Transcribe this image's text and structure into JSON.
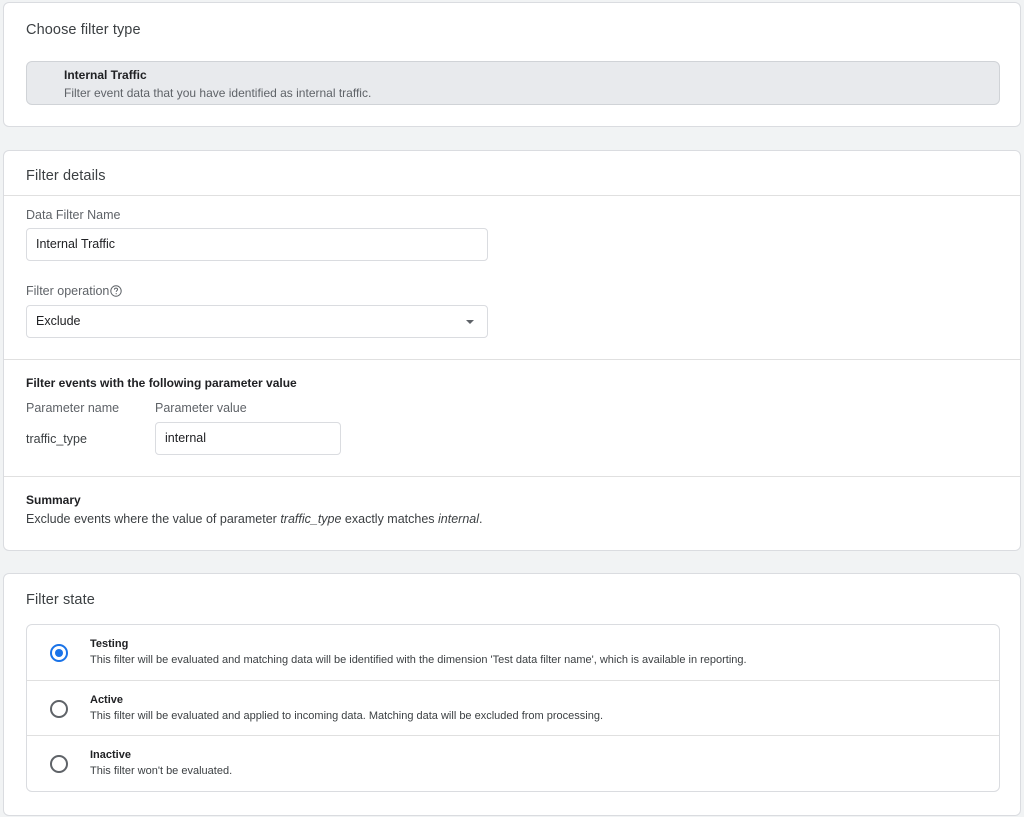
{
  "filter_type": {
    "title": "Choose filter type",
    "option": {
      "label": "Internal Traffic",
      "description": "Filter event data that you have identified as internal traffic."
    }
  },
  "filter_details": {
    "title": "Filter details",
    "name_label": "Data Filter Name",
    "name_value": "Internal Traffic",
    "operation_label": "Filter operation",
    "operation_value": "Exclude",
    "parameter_section_title": "Filter events with the following parameter value",
    "parameter_name_header": "Parameter name",
    "parameter_value_header": "Parameter value",
    "parameter_name": "traffic_type",
    "parameter_value": "internal",
    "summary_title": "Summary",
    "summary": {
      "prefix": "Exclude events where the value of parameter ",
      "param": "traffic_type",
      "middle": " exactly matches ",
      "value": "internal",
      "suffix": "."
    }
  },
  "filter_state": {
    "title": "Filter state",
    "selected": "Testing",
    "options": [
      {
        "label": "Testing",
        "description": "This filter will be evaluated and matching data will be identified with the dimension 'Test data filter name', which is available in reporting."
      },
      {
        "label": "Active",
        "description": "This filter will be evaluated and applied to incoming data. Matching data will be excluded from processing."
      },
      {
        "label": "Inactive",
        "description": "This filter won't be evaluated."
      }
    ]
  },
  "icons": {
    "help": "help-circle-icon",
    "dropdown": "caret-down-icon",
    "radio": "radio-icon"
  },
  "colors": {
    "accent": "#1a73e8",
    "page_background": "#f1f3f4",
    "selected_option_background": "#e8eaed"
  }
}
